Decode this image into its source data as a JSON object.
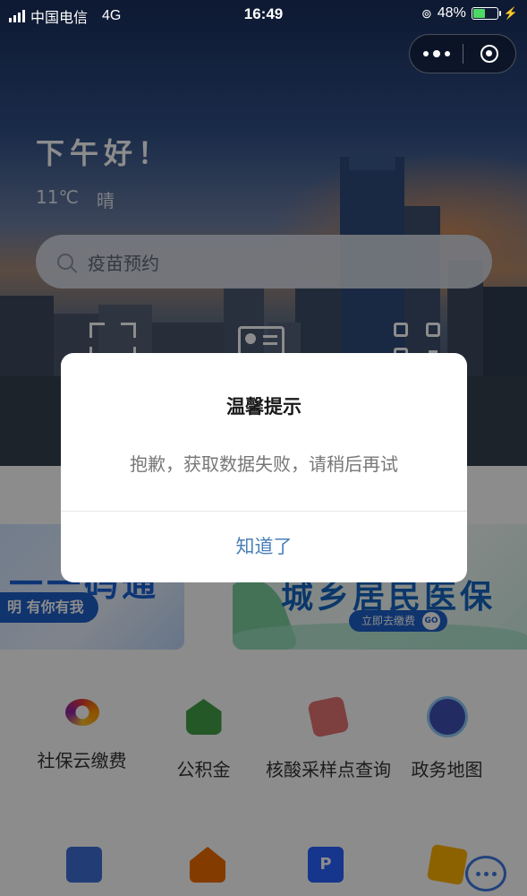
{
  "status_bar": {
    "carrier": "中国电信",
    "network": "4G",
    "time": "16:49",
    "battery_text": "48%",
    "battery_level": 0.48,
    "battery_color": "#4cd964"
  },
  "home": {
    "greeting": "下午好！",
    "temperature": "11℃",
    "weather": "晴",
    "search_placeholder": "疫苗预约"
  },
  "quick_icons": [
    "scan-icon",
    "id-card-icon",
    "qr-code-icon"
  ],
  "banners": {
    "left": {
      "title": "一一码通",
      "subtitle": "明 有你有我"
    },
    "right": {
      "title": "城乡居民医保",
      "button": "立即去缴费",
      "go": "GO"
    }
  },
  "services_row1": [
    {
      "label": "社保云缴费",
      "icon": "cloud-logo-icon"
    },
    {
      "label": "公积金",
      "icon": "house-fund-icon"
    },
    {
      "label": "核酸采样点查询",
      "icon": "test-tube-doc-icon"
    },
    {
      "label": "政务地图",
      "icon": "globe-pin-icon"
    }
  ],
  "services_row2_icons": [
    "search-card-icon",
    "home-badge-icon",
    "parking-icon",
    "calculator-icon"
  ],
  "dialog": {
    "title": "温馨提示",
    "message": "抱歉，获取数据失败，请稍后再试",
    "confirm_label": "知道了",
    "confirm_color": "#4a7fb8"
  }
}
